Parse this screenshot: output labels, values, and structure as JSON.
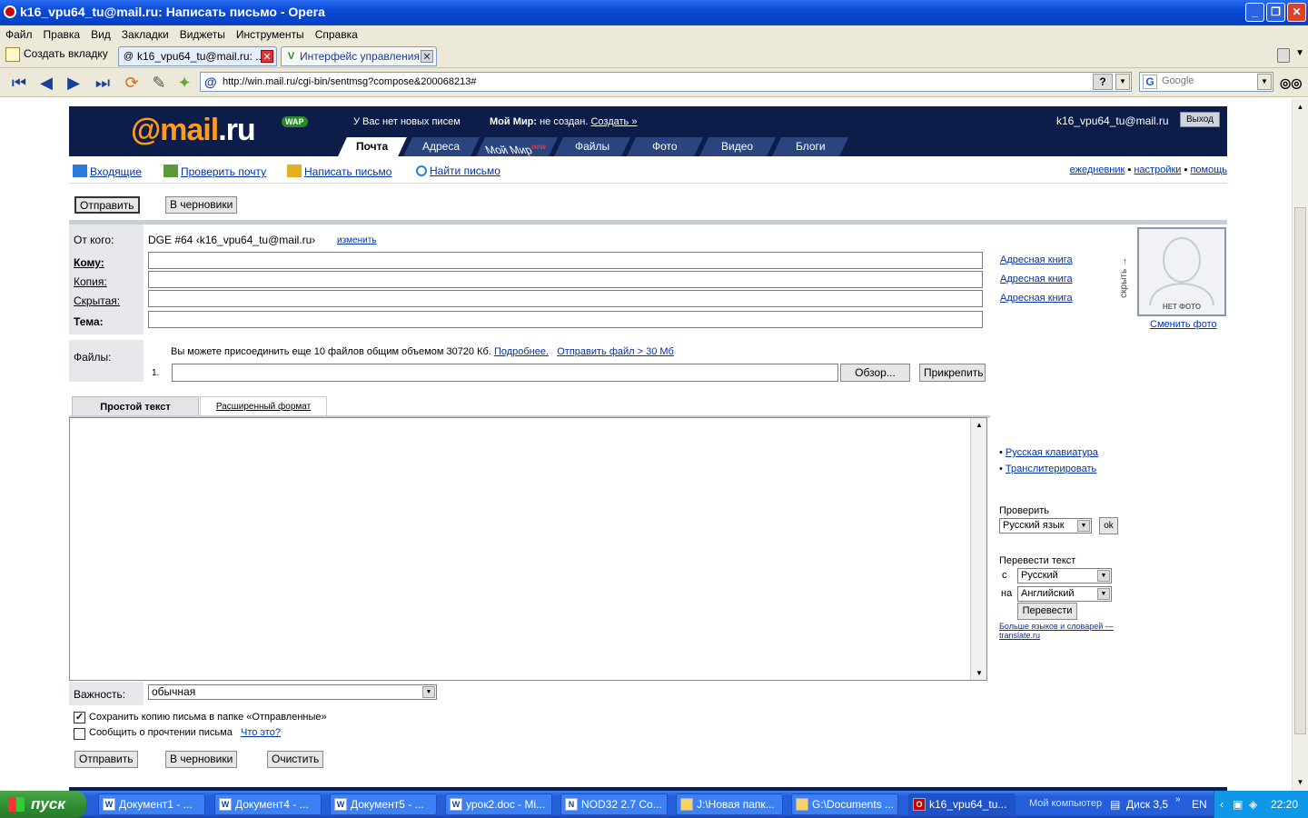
{
  "window": {
    "title": "k16_vpu64_tu@mail.ru: Написать письмо - Opera"
  },
  "menu": [
    "Файл",
    "Правка",
    "Вид",
    "Закладки",
    "Виджеты",
    "Инструменты",
    "Справка"
  ],
  "tabs": {
    "new_tab": "Создать вкладку",
    "items": [
      {
        "label": "k16_vpu64_tu@mail.ru: ..."
      },
      {
        "label": "Интерфейс управления..."
      }
    ]
  },
  "nav": {
    "url": "http://win.mail.ru/cgi-bin/sentmsg?compose&200068213#",
    "search_placeholder": "Google",
    "help": "?"
  },
  "mailru": {
    "logo_at": "@mail",
    "logo_ru": ".ru",
    "wap": "WAP",
    "no_mail": "У Вас нет новых писем",
    "my_world_label": "Мой Мир:",
    "my_world_status": "не создан.",
    "my_world_create": "Создать »",
    "user_email": "k16_vpu64_tu@mail.ru",
    "logout": "Выход",
    "tabs": [
      "Почта",
      "Адреса",
      "Мой Мир",
      "Файлы",
      "Фото",
      "Видео",
      "Блоги"
    ],
    "new_badge": "new"
  },
  "actions": {
    "inbox": "Входящие",
    "check": "Проверить почту",
    "compose": "Написать письмо",
    "find": "Найти письмо",
    "diary": "ежедневник",
    "settings": "настройки",
    "help": "помощь"
  },
  "compose": {
    "send": "Отправить",
    "drafts": "В черновики",
    "clear": "Очистить",
    "from_label": "От кого:",
    "from_value": "DGE #64 ‹k16_vpu64_tu@mail.ru›",
    "change": "изменить",
    "to_label": "Кому:",
    "cc_label": "Копия:",
    "bcc_label": "Скрытая:",
    "subject_label": "Тема:",
    "address_book": "Адресная книга",
    "files_label": "Файлы:",
    "files_info": "Вы можете присоединить еще 10 файлов общим объемом 30720 Кб.",
    "more": "Подробнее.",
    "send_big": "Отправить файл > 30 Мб",
    "file_num": "1.",
    "browse": "Обзор...",
    "attach": "Прикрепить",
    "tab_plain": "Простой текст",
    "tab_rich": "Расширенный формат",
    "importance_label": "Важность:",
    "importance_value": "обычная",
    "save_copy": "Сохранить копию письма в папке «Отправленные»",
    "save_copy_checked": true,
    "notify_read": "Сообщить о прочтении письма",
    "what_is": "Что это?",
    "hide": "скрыть →",
    "no_photo": "НЕТ ФОТО",
    "change_photo": "Сменить фото"
  },
  "sidebar": {
    "ru_keyboard": "Русская клавиатура",
    "translit": "Транслитерировать",
    "check_label": "Проверить",
    "check_lang": "Русский язык",
    "ok": "ok",
    "translate_label": "Перевести текст",
    "from": "с",
    "from_lang": "Русский",
    "to": "на",
    "to_lang": "Английский",
    "translate_btn": "Перевести",
    "more_langs_1": "Больше языков и словарей —",
    "more_langs_2": "translate.ru"
  },
  "taskbar": {
    "start": "пуск",
    "items": [
      "Документ1 - ...",
      "Документ4 - ...",
      "Документ5 - ...",
      "урок2.doc - Mi...",
      "NOD32 2.7 Co...",
      "J:\\Новая папк...",
      "G:\\Documents ...",
      "k16_vpu64_tu..."
    ],
    "my_computer": "Мой компьютер",
    "disk": "Диск 3,5",
    "lang": "EN",
    "time": "22:20"
  }
}
